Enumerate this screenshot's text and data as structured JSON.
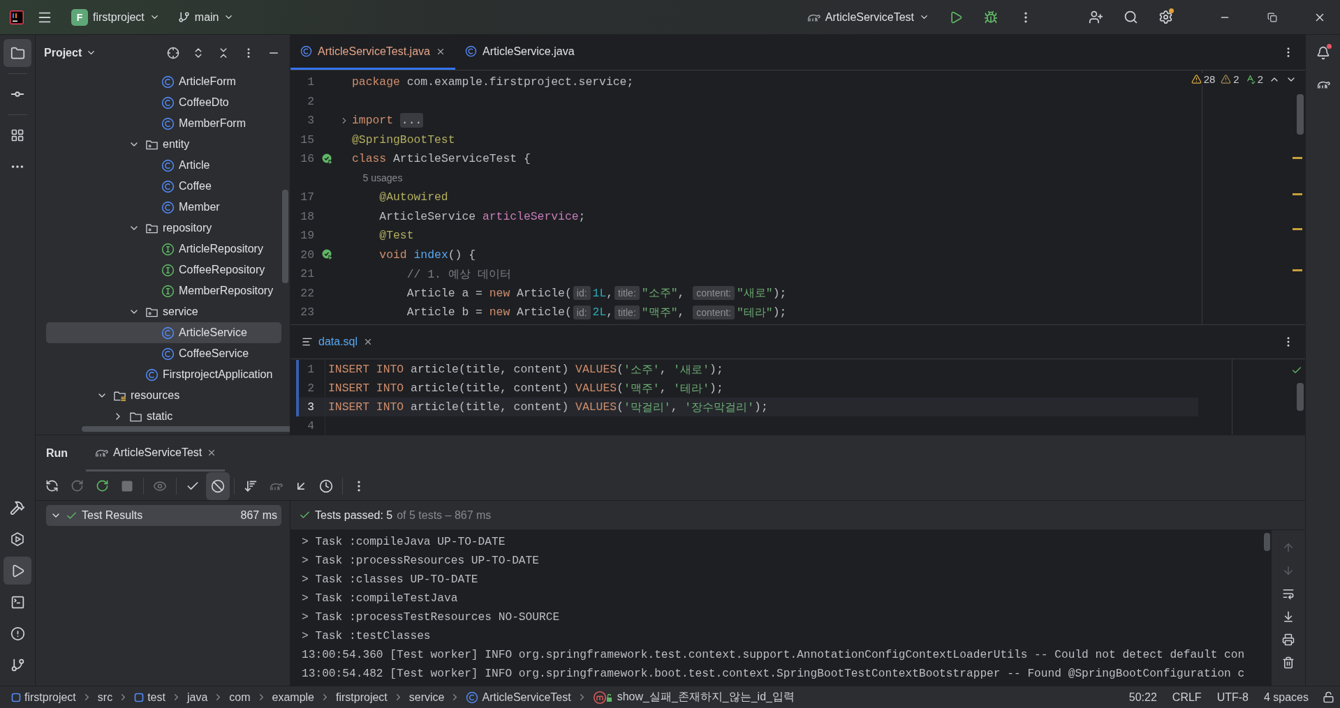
{
  "title_bar": {
    "project_badge": "F",
    "project": "firstproject",
    "branch": "main",
    "run_config": "ArticleServiceTest"
  },
  "tool_strip_left": [
    {
      "kind": "project",
      "selected": true
    },
    {
      "kind": "commit",
      "selected": false
    },
    {
      "kind": "structure",
      "selected": false
    },
    {
      "kind": "more",
      "selected": false
    }
  ],
  "tool_strip_left_bottom": [
    {
      "kind": "build",
      "selected": false
    },
    {
      "kind": "services",
      "selected": false
    },
    {
      "kind": "run",
      "selected": true
    },
    {
      "kind": "terminal",
      "selected": false
    },
    {
      "kind": "problems",
      "selected": false
    },
    {
      "kind": "git",
      "selected": false
    }
  ],
  "project_panel": {
    "title": "Project",
    "tree": [
      {
        "children": [
          {
            "children": [
              {
                "children": [
                  {
                    "label": "ArticleForm",
                    "kind": "class",
                    "selected": false
                  },
                  {
                    "label": "CoffeeDto",
                    "kind": "class",
                    "selected": false
                  },
                  {
                    "label": "MemberForm",
                    "kind": "class",
                    "selected": false
                  }
                ]
              },
              {
                "label": "entity",
                "kind": "package",
                "expanded": true,
                "selected": false,
                "children": [
                  {
                    "label": "Article",
                    "kind": "class",
                    "selected": false
                  },
                  {
                    "label": "Coffee",
                    "kind": "class",
                    "selected": false
                  },
                  {
                    "label": "Member",
                    "kind": "class",
                    "selected": false
                  }
                ]
              },
              {
                "label": "repository",
                "kind": "package",
                "expanded": true,
                "selected": false,
                "children": [
                  {
                    "label": "ArticleRepository",
                    "kind": "interface",
                    "selected": false
                  },
                  {
                    "label": "CoffeeRepository",
                    "kind": "interface",
                    "selected": false
                  },
                  {
                    "label": "MemberRepository",
                    "kind": "interface",
                    "selected": false
                  }
                ]
              },
              {
                "label": "service",
                "kind": "package",
                "expanded": true,
                "selected": false,
                "children": [
                  {
                    "label": "ArticleService",
                    "kind": "class",
                    "selected": true
                  },
                  {
                    "label": "CoffeeService",
                    "kind": "class",
                    "selected": false
                  }
                ]
              },
              {
                "label": "FirstprojectApplication",
                "kind": "class",
                "selected": false
              }
            ]
          }
        ]
      },
      {
        "label": "resources",
        "kind": "resources",
        "expanded": true,
        "selected": false,
        "children": [
          {
            "label": "static",
            "kind": "folder",
            "expanded": false,
            "selected": false
          }
        ]
      }
    ]
  },
  "editor_tabs": [
    {
      "label": "ArticleServiceTest.java",
      "selected": true
    },
    {
      "label": "ArticleService.java",
      "selected": false
    }
  ],
  "inspections": [
    {
      "kind": "warning",
      "count": "28"
    },
    {
      "kind": "weak_warning",
      "count": "2"
    },
    {
      "kind": "typo",
      "count": "2"
    }
  ],
  "code_lines": [
    {
      "number": "1",
      "runnable": false,
      "foldable": false,
      "tokens": [
        {
          "kind": "keyword",
          "text": "package"
        },
        {
          "kind": "plain",
          "text": " com.example.firstproject.service;"
        }
      ]
    },
    {
      "number": "2",
      "runnable": false,
      "foldable": false
    },
    {
      "number": "3",
      "runnable": false,
      "foldable": true,
      "tokens": [
        {
          "kind": "keyword",
          "text": "import"
        },
        {
          "kind": "folded",
          "text": "..."
        }
      ]
    },
    {
      "number": "15",
      "runnable": false,
      "foldable": false,
      "tokens": [
        {
          "kind": "annotation",
          "text": "@SpringBootTest"
        }
      ]
    },
    {
      "number": "16",
      "runnable": true,
      "foldable": false,
      "tokens": [
        {
          "kind": "keyword",
          "text": "class"
        },
        {
          "kind": "plain",
          "text": " ArticleServiceTest {"
        }
      ]
    },
    {
      "runnable": false,
      "foldable": false,
      "tokens": [
        {
          "kind": "usage",
          "text": "    5 usages"
        }
      ]
    },
    {
      "number": "17",
      "runnable": false,
      "foldable": false,
      "tokens": [
        {
          "kind": "annotation",
          "text": "    @Autowired"
        }
      ]
    },
    {
      "number": "18",
      "runnable": false,
      "foldable": false,
      "tokens": [
        {
          "kind": "plain",
          "text": "    ArticleService "
        },
        {
          "kind": "field",
          "text": "articleService"
        },
        {
          "kind": "plain",
          "text": ";"
        }
      ]
    },
    {
      "number": "19",
      "runnable": false,
      "foldable": false,
      "tokens": [
        {
          "kind": "annotation",
          "text": "    @Test"
        }
      ]
    },
    {
      "number": "20",
      "runnable": true,
      "foldable": false,
      "tokens": [
        {
          "kind": "keyword",
          "text": "    void "
        },
        {
          "kind": "method",
          "text": "index"
        },
        {
          "kind": "plain",
          "text": "() {"
        }
      ]
    },
    {
      "number": "21",
      "runnable": false,
      "foldable": false,
      "tokens": [
        {
          "kind": "comment",
          "text": "        // 1. 예상 데이터"
        }
      ]
    },
    {
      "number": "22",
      "runnable": false,
      "foldable": false,
      "tokens": [
        {
          "kind": "plain",
          "text": "        Article a = "
        },
        {
          "kind": "keyword",
          "text": "new"
        },
        {
          "kind": "plain",
          "text": " Article("
        },
        {
          "kind": "hint",
          "text": "id:"
        },
        {
          "kind": "number",
          "text": "1L"
        },
        {
          "kind": "plain",
          "text": ","
        },
        {
          "kind": "hint",
          "text": "title:"
        },
        {
          "kind": "string",
          "text": "\"소주\""
        },
        {
          "kind": "plain",
          "text": ", "
        },
        {
          "kind": "hint",
          "text": "content:"
        },
        {
          "kind": "string",
          "text": "\"새로\""
        },
        {
          "kind": "plain",
          "text": ");"
        }
      ]
    },
    {
      "number": "23",
      "runnable": false,
      "foldable": false,
      "tokens": [
        {
          "kind": "plain",
          "text": "        Article b = "
        },
        {
          "kind": "keyword",
          "text": "new"
        },
        {
          "kind": "plain",
          "text": " Article("
        },
        {
          "kind": "hint",
          "text": "id:"
        },
        {
          "kind": "number",
          "text": "2L"
        },
        {
          "kind": "plain",
          "text": ","
        },
        {
          "kind": "hint",
          "text": "title:"
        },
        {
          "kind": "string",
          "text": "\"맥주\""
        },
        {
          "kind": "plain",
          "text": ", "
        },
        {
          "kind": "hint",
          "text": "content:"
        },
        {
          "kind": "string",
          "text": "\"테라\""
        },
        {
          "kind": "plain",
          "text": ");"
        }
      ]
    }
  ],
  "sql_tab": {
    "label": "data.sql"
  },
  "sql_lines": [
    {
      "number": "1",
      "changed": true,
      "current": false,
      "tokens": [
        {
          "kind": "keyword",
          "text": "INSERT INTO"
        },
        {
          "kind": "plain",
          "text": " article(title, content) "
        },
        {
          "kind": "keyword",
          "text": "VALUES"
        },
        {
          "kind": "plain",
          "text": "("
        },
        {
          "kind": "string",
          "text": "'소주'"
        },
        {
          "kind": "plain",
          "text": ", "
        },
        {
          "kind": "string",
          "text": "'새로'"
        },
        {
          "kind": "plain",
          "text": ");"
        }
      ]
    },
    {
      "number": "2",
      "changed": true,
      "current": false,
      "tokens": [
        {
          "kind": "keyword",
          "text": "INSERT INTO"
        },
        {
          "kind": "plain",
          "text": " article(title, content) "
        },
        {
          "kind": "keyword",
          "text": "VALUES"
        },
        {
          "kind": "plain",
          "text": "("
        },
        {
          "kind": "string",
          "text": "'맥주'"
        },
        {
          "kind": "plain",
          "text": ", "
        },
        {
          "kind": "string",
          "text": "'테라'"
        },
        {
          "kind": "plain",
          "text": ");"
        }
      ]
    },
    {
      "number": "3",
      "changed": true,
      "current": true,
      "tokens": [
        {
          "kind": "keyword",
          "text": "INSERT INTO"
        },
        {
          "kind": "plain",
          "text": " article(title, content) "
        },
        {
          "kind": "keyword",
          "text": "VALUES"
        },
        {
          "kind": "plain",
          "text": "("
        },
        {
          "kind": "string",
          "text": "'막걸리'"
        },
        {
          "kind": "plain",
          "text": ", "
        },
        {
          "kind": "string",
          "text": "'장수막걸리'"
        },
        {
          "kind": "plain",
          "text": ");"
        }
      ]
    },
    {
      "number": "4",
      "changed": false,
      "current": false
    }
  ],
  "run_panel": {
    "title": "Run",
    "tab": "ArticleServiceTest",
    "toolbar": [
      {
        "kind": "rerun",
        "disabled": false
      },
      {
        "kind": "rerun_failed",
        "disabled": true
      },
      {
        "kind": "toggle_rerun",
        "disabled": false
      },
      {
        "kind": "stop",
        "disabled": true
      },
      {
        "kind": "sep"
      },
      {
        "kind": "view",
        "disabled": true
      },
      {
        "kind": "sep"
      },
      {
        "kind": "show_passed",
        "disabled": false
      },
      {
        "kind": "show_ignored",
        "disabled": false,
        "selected": true
      },
      {
        "kind": "sep"
      },
      {
        "kind": "sort",
        "disabled": false
      },
      {
        "kind": "import",
        "disabled": true
      },
      {
        "kind": "collapse",
        "disabled": false
      },
      {
        "kind": "history",
        "disabled": false
      },
      {
        "kind": "sep"
      },
      {
        "kind": "more",
        "disabled": false
      }
    ],
    "results": [
      {
        "label": "Test Results",
        "time": "867 ms",
        "passed": true,
        "expanded": true,
        "selected": true
      }
    ],
    "summary": {
      "label": "Tests passed: 5",
      "detail": "of 5 tests – 867 ms"
    },
    "console": [
      "> Task :compileJava UP-TO-DATE",
      "> Task :processResources UP-TO-DATE",
      "> Task :classes UP-TO-DATE",
      "> Task :compileTestJava",
      "> Task :processTestResources NO-SOURCE",
      "> Task :testClasses",
      "13:00:54.360 [Test worker] INFO org.springframework.test.context.support.AnnotationConfigContextLoaderUtils -- Could not detect default con",
      "13:00:54.482 [Test worker] INFO org.springframework.boot.test.context.SpringBootTestContextBootstrapper -- Found @SpringBootConfiguration c"
    ]
  },
  "status_bar": {
    "breadcrumbs": [
      {
        "label": "firstproject",
        "kind": "module"
      },
      {
        "label": "src",
        "kind": "folder"
      },
      {
        "label": "test",
        "kind": "module"
      },
      {
        "label": "java",
        "kind": "folder"
      },
      {
        "label": "com",
        "kind": "folder"
      },
      {
        "label": "example",
        "kind": "folder"
      },
      {
        "label": "firstproject",
        "kind": "folder"
      },
      {
        "label": "service",
        "kind": "folder"
      },
      {
        "label": "ArticleServiceTest",
        "kind": "class"
      },
      {
        "label": "show_실패_존재하지_않는_id_입력",
        "kind": "method"
      }
    ],
    "position": "50:22",
    "line_separator": "CRLF",
    "encoding": "UTF-8",
    "indent": "4 spaces"
  }
}
